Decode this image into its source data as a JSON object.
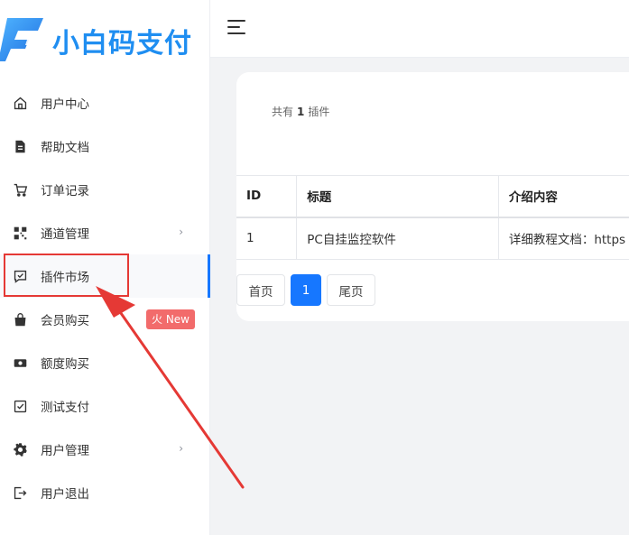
{
  "app": {
    "logo_text": "小白码支付"
  },
  "sidebar": {
    "items": [
      {
        "label": "用户中心",
        "icon": "home-icon"
      },
      {
        "label": "帮助文档",
        "icon": "document-icon"
      },
      {
        "label": "订单记录",
        "icon": "cart-icon"
      },
      {
        "label": "通道管理",
        "icon": "qrcode-icon",
        "chevron": "›"
      },
      {
        "label": "插件市场",
        "icon": "chat-check-icon",
        "active": true
      },
      {
        "label": "会员购买",
        "icon": "bag-icon",
        "badge": "火 New"
      },
      {
        "label": "额度购买",
        "icon": "money-icon"
      },
      {
        "label": "测试支付",
        "icon": "checkbox-icon"
      },
      {
        "label": "用户管理",
        "icon": "gear-icon",
        "chevron": "›"
      },
      {
        "label": "用户退出",
        "icon": "logout-icon"
      }
    ]
  },
  "plugins": {
    "summary_prefix": "共有",
    "summary_count": "1",
    "summary_suffix": "插件",
    "columns": [
      "ID",
      "标题",
      "介绍内容"
    ],
    "rows": [
      {
        "id": "1",
        "title": "PC自挂监控软件",
        "desc": "详细教程文档：https"
      }
    ]
  },
  "pagination": {
    "first": "首页",
    "current": "1",
    "last": "尾页"
  },
  "colors": {
    "accent": "#1677ff",
    "badge": "#f26b6b",
    "annotation": "#e53935",
    "logo": "#1f8ef1"
  }
}
